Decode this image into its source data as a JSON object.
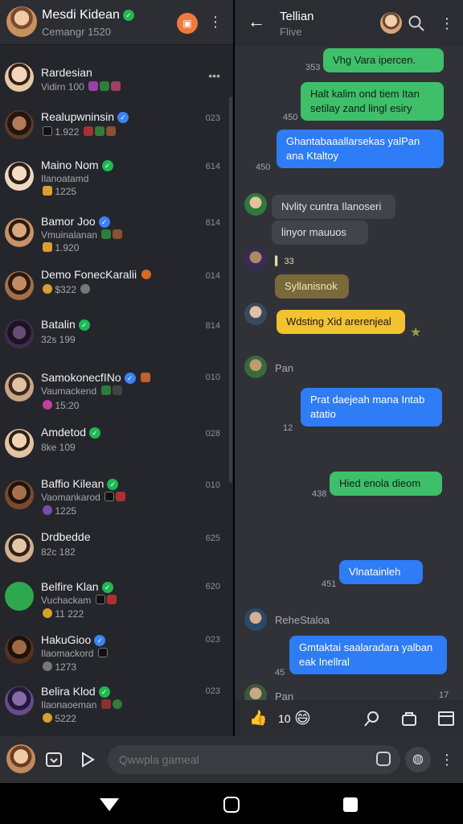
{
  "left_header": {
    "name": "Mesdi Kidean",
    "subtitle": "Cemangr 1520",
    "menu_icon": "kebab-icon"
  },
  "chats": [
    {
      "name": "Rardesian",
      "sub": "Vidirn 100",
      "time": "",
      "avatar": "#d9b38c",
      "verified": "",
      "more": "•••"
    },
    {
      "name": "Realuрwninsin",
      "sub": "1.922",
      "time": "023",
      "avatar": "#5a3a2a",
      "verified": "blue",
      "more": ""
    },
    {
      "name": "Maino Nom",
      "sub": "Ilanoatamd",
      "sub2": "1225",
      "time": "614",
      "avatar": "#e8d1b5",
      "verified": "green",
      "more": ""
    },
    {
      "name": "Bamor Joo",
      "sub": "Vmuinalanan",
      "sub2": "1.920",
      "time": "814",
      "avatar": "#c48d5f",
      "verified": "blue",
      "more": ""
    },
    {
      "name": "Demo FoneсKaralii",
      "sub": "$322",
      "time": "014",
      "avatar": "#b07852",
      "verified": "",
      "more": ""
    },
    {
      "name": "Batalin",
      "sub": "32s 199",
      "time": "814",
      "avatar": "#4a3a5a",
      "verified": "green",
      "more": ""
    },
    {
      "name": "SamokonecfINo",
      "sub": "Vaumackend",
      "sub2": "15:20",
      "time": "010",
      "avatar": "#caa585",
      "verified": "blue",
      "more": ""
    },
    {
      "name": "Amdetod",
      "sub": "8ke 109",
      "time": "028",
      "avatar": "#e0c0a0",
      "verified": "green",
      "more": ""
    },
    {
      "name": "Baffio Kilean",
      "sub": "Vaomankarod",
      "sub2": "1225",
      "time": "010",
      "avatar": "#7a4a30",
      "verified": "green",
      "more": ""
    },
    {
      "name": "Drdbedde",
      "sub": "82c 182",
      "time": "625",
      "avatar": "#d2b090",
      "verified": "",
      "more": ""
    },
    {
      "name": "Belfire Klan",
      "sub": "Vuchackam",
      "sub2": "11 222",
      "time": "620",
      "avatar": "#2ea84e",
      "verified": "green",
      "more": ""
    },
    {
      "name": "HakuGioo",
      "sub": "Ilaomackord",
      "sub2": "1273",
      "time": "023",
      "avatar": "#5a3020",
      "verified": "blue",
      "more": ""
    },
    {
      "name": "Belira Klod",
      "sub": "Ilaonaoeman",
      "sub2": "5222",
      "time": "023",
      "avatar": "#6a4a8a",
      "verified": "green",
      "more": ""
    }
  ],
  "right_header": {
    "back_icon": "arrow-left-icon",
    "name": "Tellian",
    "status": "Flive",
    "search_icon": "search-icon",
    "menu_icon": "kebab-icon"
  },
  "messages": {
    "m1_text": "Vhg Vara ipercen.",
    "m1_time": "353",
    "m2_text": "Halt kalim ond tiem Itan setilay zand lingl esiry",
    "m2_time": "450",
    "m3_text": "Ghantabaaallarsekas yalPan ana Ktaltoy",
    "m3_time": "450",
    "m4_text": "Nvlity cuntra Ilanoseri",
    "m5_text": "linyor mauuos",
    "m6_meta": "33",
    "m7_text": "Syllanisnok",
    "m8_text": "Wdsting Xid arerenjeal",
    "m9_sender": "Pan",
    "m10_text": "Prat daejeah mana Intab atatio",
    "m10_time": "12",
    "m11_text": "Hied enola dieom",
    "m11_time": "438",
    "m12_text": "Vlnatainleh",
    "m12_time": "451",
    "m13_sender": "ReheStaloa",
    "m14_text": "Gmtaktai saalaradara yalban eak Inellral",
    "m14_time": "45",
    "m15_sender": "Pan",
    "m15_time": "17"
  },
  "right_footer": {
    "count": "10",
    "like_icon": "thumbs-up-icon",
    "emoji_icon": "emoji-icon",
    "search_icon": "magnifier-icon",
    "bag_icon": "bag-icon",
    "window_icon": "window-icon"
  },
  "compose": {
    "placeholder": "Qwwpla gameal",
    "attach_icon": "gif-icon",
    "play_icon": "play-icon",
    "sticker_icon": "sticker-icon",
    "globe_icon": "globe-icon",
    "menu_icon": "kebab-icon"
  },
  "navbar": {
    "back_icon": "nav-back-icon",
    "home_icon": "nav-home-icon",
    "recents_icon": "nav-recents-icon"
  }
}
